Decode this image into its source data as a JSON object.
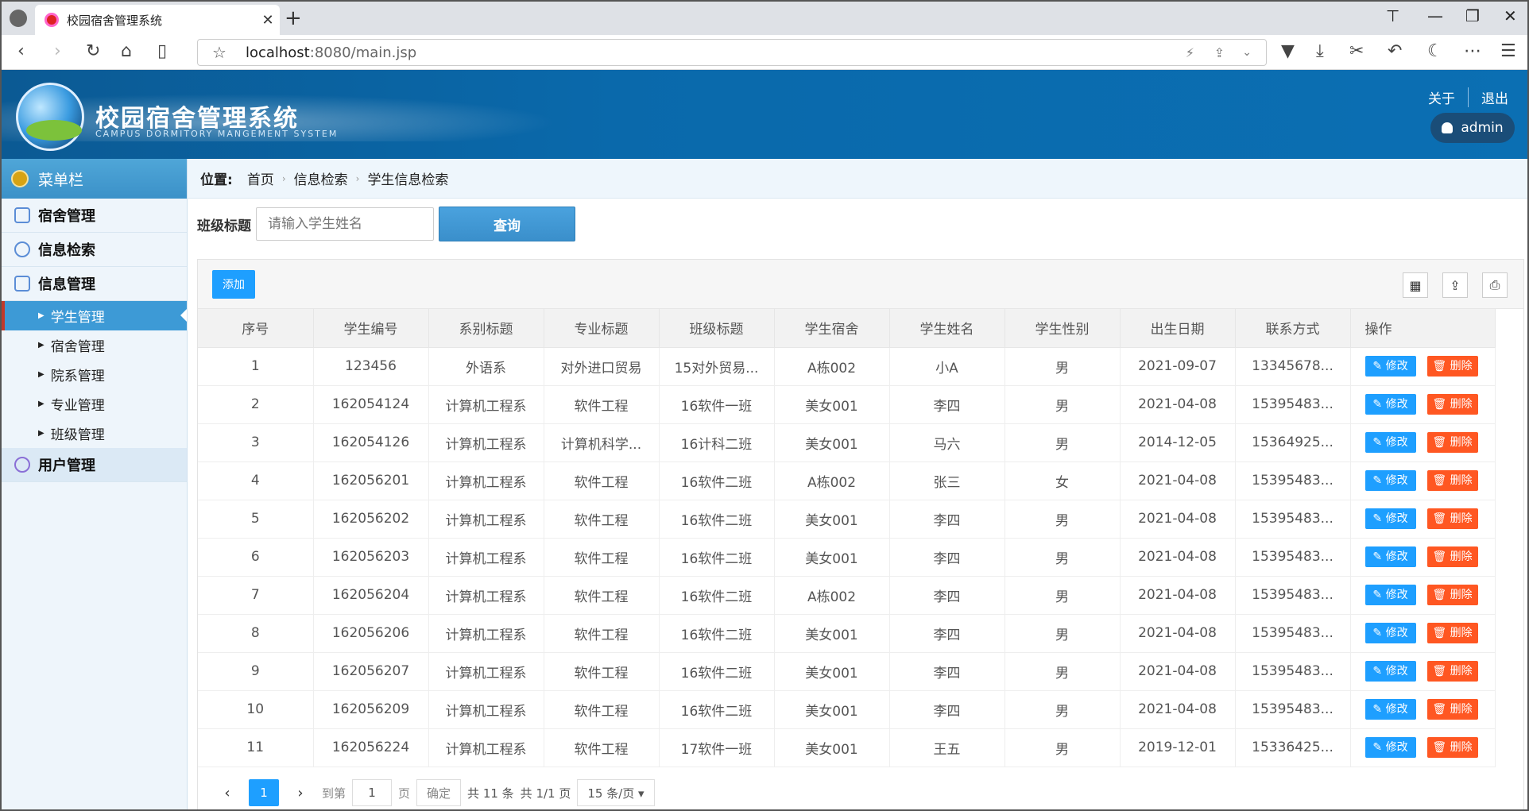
{
  "browser": {
    "tab_title": "校园宿舍管理系统",
    "url_host": "localhost",
    "url_rest": ":8080/main.jsp"
  },
  "header": {
    "title": "校园宿舍管理系统",
    "subtitle": "CAMPUS DORMITORY MANGEMENT SYSTEM",
    "about": "关于",
    "logout": "退出",
    "user": "admin"
  },
  "sidebar": {
    "menu_title": "菜单栏",
    "groups": [
      "宿舍管理",
      "信息检索",
      "信息管理",
      "用户管理"
    ],
    "subs": [
      "学生管理",
      "宿舍管理",
      "院系管理",
      "专业管理",
      "班级管理"
    ]
  },
  "crumb": {
    "label": "位置:",
    "items": [
      "首页",
      "信息检索",
      "学生信息检索"
    ]
  },
  "search": {
    "label": "班级标题",
    "placeholder": "请输入学生姓名",
    "button": "查询"
  },
  "toolbar": {
    "add": "添加"
  },
  "table": {
    "headers": [
      "序号",
      "学生编号",
      "系别标题",
      "专业标题",
      "班级标题",
      "学生宿舍",
      "学生姓名",
      "学生性别",
      "出生日期",
      "联系方式",
      "操作"
    ],
    "edit_label": "修改",
    "delete_label": "删除",
    "rows": [
      [
        "1",
        "123456",
        "外语系",
        "对外进口贸易",
        "15对外贸易...",
        "A栋002",
        "小A",
        "男",
        "2021-09-07",
        "13345678..."
      ],
      [
        "2",
        "162054124",
        "计算机工程系",
        "软件工程",
        "16软件一班",
        "美女001",
        "李四",
        "男",
        "2021-04-08",
        "15395483..."
      ],
      [
        "3",
        "162054126",
        "计算机工程系",
        "计算机科学...",
        "16计科二班",
        "美女001",
        "马六",
        "男",
        "2014-12-05",
        "15364925..."
      ],
      [
        "4",
        "162056201",
        "计算机工程系",
        "软件工程",
        "16软件二班",
        "A栋002",
        "张三",
        "女",
        "2021-04-08",
        "15395483..."
      ],
      [
        "5",
        "162056202",
        "计算机工程系",
        "软件工程",
        "16软件二班",
        "美女001",
        "李四",
        "男",
        "2021-04-08",
        "15395483..."
      ],
      [
        "6",
        "162056203",
        "计算机工程系",
        "软件工程",
        "16软件二班",
        "美女001",
        "李四",
        "男",
        "2021-04-08",
        "15395483..."
      ],
      [
        "7",
        "162056204",
        "计算机工程系",
        "软件工程",
        "16软件二班",
        "A栋002",
        "李四",
        "男",
        "2021-04-08",
        "15395483..."
      ],
      [
        "8",
        "162056206",
        "计算机工程系",
        "软件工程",
        "16软件二班",
        "美女001",
        "李四",
        "男",
        "2021-04-08",
        "15395483..."
      ],
      [
        "9",
        "162056207",
        "计算机工程系",
        "软件工程",
        "16软件二班",
        "美女001",
        "李四",
        "男",
        "2021-04-08",
        "15395483..."
      ],
      [
        "10",
        "162056209",
        "计算机工程系",
        "软件工程",
        "16软件二班",
        "美女001",
        "李四",
        "男",
        "2021-04-08",
        "15395483..."
      ],
      [
        "11",
        "162056224",
        "计算机工程系",
        "软件工程",
        "17软件一班",
        "美女001",
        "王五",
        "男",
        "2019-12-01",
        "15336425..."
      ]
    ]
  },
  "pager": {
    "current": "1",
    "goto_label": "到第",
    "goto_value": "1",
    "page_unit": "页",
    "confirm": "确定",
    "total": "共 11 条",
    "pages": "共 1/1 页",
    "per_page": "15 条/页 ▾"
  }
}
